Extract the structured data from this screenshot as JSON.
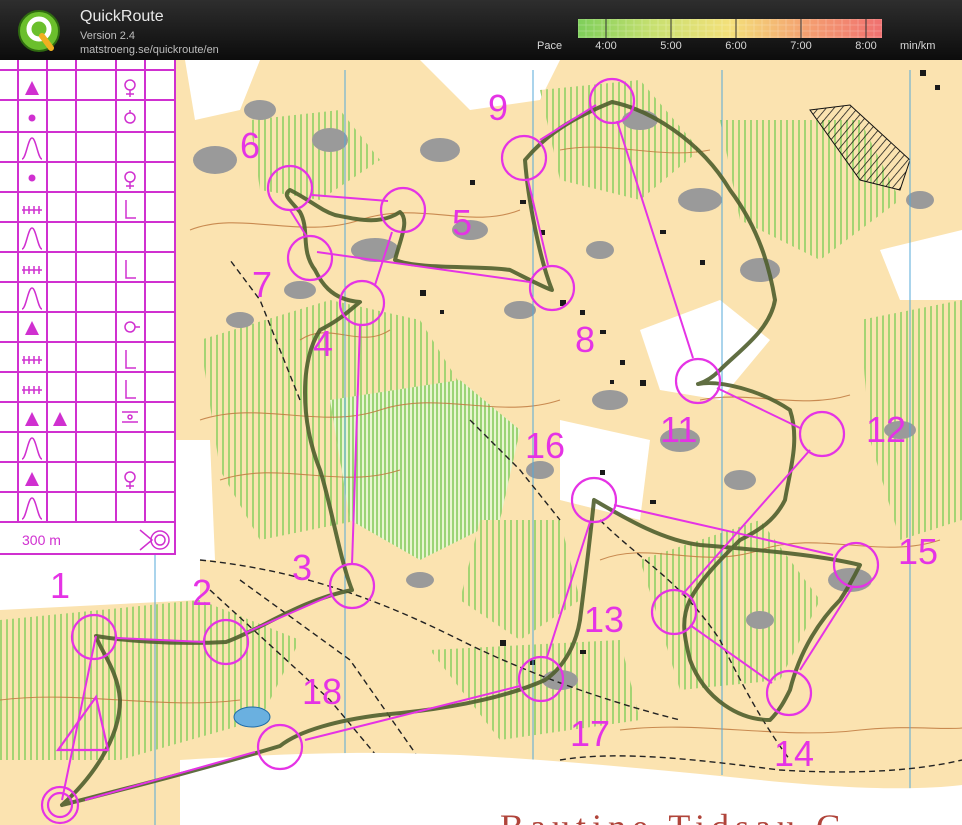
{
  "header": {
    "title": "QuickRoute",
    "version": "Version 2.4",
    "url": "matstroeng.se/quickroute/en",
    "logo_icon": "quickroute-q-logo-icon"
  },
  "pace_legend": {
    "label": "Pace",
    "ticks": [
      "4:00",
      "5:00",
      "6:00",
      "7:00",
      "8:00"
    ],
    "unit": "min/km",
    "colors": [
      "#7ecf5a",
      "#c8e070",
      "#f4e07a",
      "#f4a070",
      "#f07070"
    ]
  },
  "map": {
    "scale_text": "300 m",
    "bottom_text": "Bautine Tidsau G",
    "control_color": "#e533e5",
    "route_color": "#3c4a2a",
    "controls": [
      "1",
      "2",
      "3",
      "4",
      "5",
      "6",
      "7",
      "8",
      "9",
      "11",
      "12",
      "13",
      "14",
      "15",
      "16",
      "17",
      "18"
    ]
  },
  "colors": {
    "open_land": "#fbe3b0",
    "forest": "#ffffff",
    "green_vegetation": "#a8dc82",
    "rock": "#9a9a9a",
    "contour": "#c07a40",
    "water": "#6ab0e0"
  }
}
